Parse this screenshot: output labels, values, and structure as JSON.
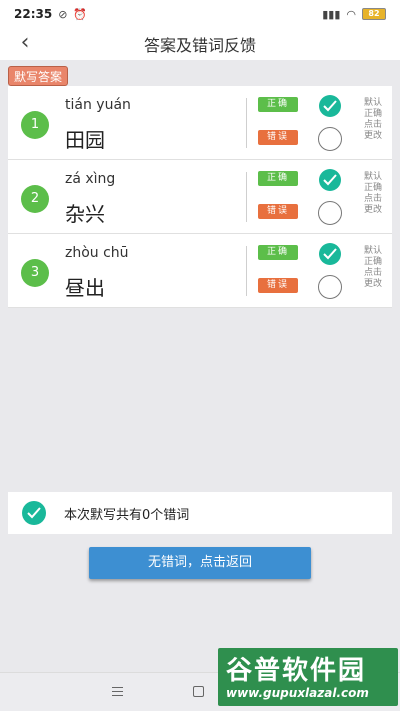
{
  "status_bar": {
    "time": "22:35",
    "battery": "82"
  },
  "header": {
    "back_icon": "chevron-left-icon",
    "title": "答案及错词反馈"
  },
  "section_tag": "默写答案",
  "items": [
    {
      "number": "1",
      "pinyin": "tián yuán",
      "hanzi": "田园",
      "correct_label": "正确",
      "wrong_label": "错误",
      "selected": "correct",
      "hint": "默认正确点击更改"
    },
    {
      "number": "2",
      "pinyin": "zá xìng",
      "hanzi": "杂兴",
      "correct_label": "正确",
      "wrong_label": "错误",
      "selected": "correct",
      "hint": "默认正确点击更改"
    },
    {
      "number": "3",
      "pinyin": "zhòu chū",
      "hanzi": "昼出",
      "correct_label": "正确",
      "wrong_label": "错误",
      "selected": "correct",
      "hint": "默认正确点击更改"
    }
  ],
  "summary": {
    "text": "本次默写共有0个错词"
  },
  "return_button": "无错词，点击返回",
  "watermark": {
    "title": "谷普软件园",
    "url": "www.gupuxlazal.com"
  },
  "colors": {
    "green": "#5cbe4a",
    "orange": "#e8703e",
    "teal": "#19b89a",
    "blue": "#3d8fd2",
    "tag": "#e9856a"
  }
}
